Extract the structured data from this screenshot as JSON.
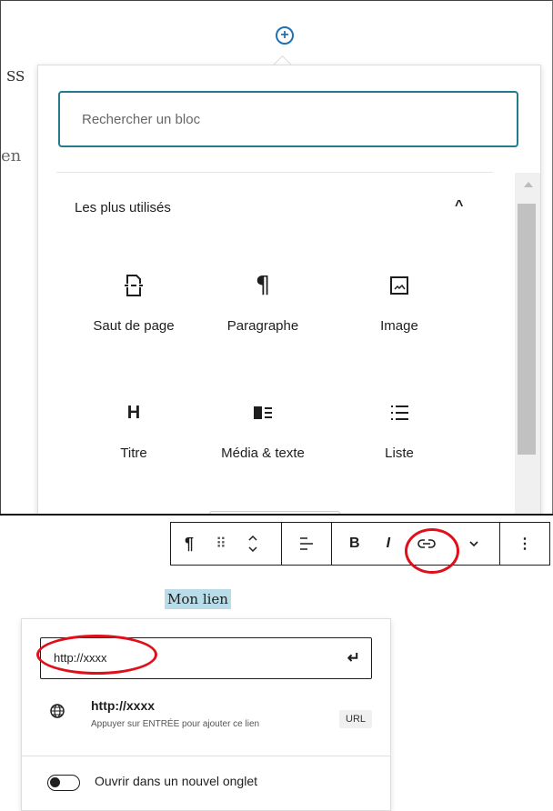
{
  "background": {
    "fragment_1": "SS",
    "fragment_2": "en"
  },
  "inserter": {
    "search_placeholder": "Rechercher un bloc",
    "section_title": "Les plus utilisés",
    "blocks": [
      {
        "label": "Saut de page",
        "icon": "page-break-icon"
      },
      {
        "label": "Paragraphe",
        "icon": "paragraph-icon"
      },
      {
        "label": "Image",
        "icon": "image-icon"
      },
      {
        "label": "Titre",
        "icon": "heading-icon"
      },
      {
        "label": "Média & texte",
        "icon": "media-text-icon"
      },
      {
        "label": "Liste",
        "icon": "list-icon"
      }
    ]
  },
  "toolbar": {
    "paragraph": "¶",
    "drag": "⠿",
    "bold": "B",
    "italic": "I",
    "more": "⋮"
  },
  "editor": {
    "selected_text": "Mon lien"
  },
  "link_popover": {
    "url_value": "http://xxxx",
    "suggestion_title": "http://xxxx",
    "suggestion_subtitle": "Appuyer sur ENTRÉE pour ajouter ce lien",
    "badge": "URL",
    "new_tab_label": "Ouvrir dans un nouvel onglet",
    "new_tab_enabled": false
  },
  "colors": {
    "accent": "#237b8c",
    "highlight": "#b8dce8",
    "annotation": "#e0101a",
    "plus_icon": "#2271b1"
  }
}
